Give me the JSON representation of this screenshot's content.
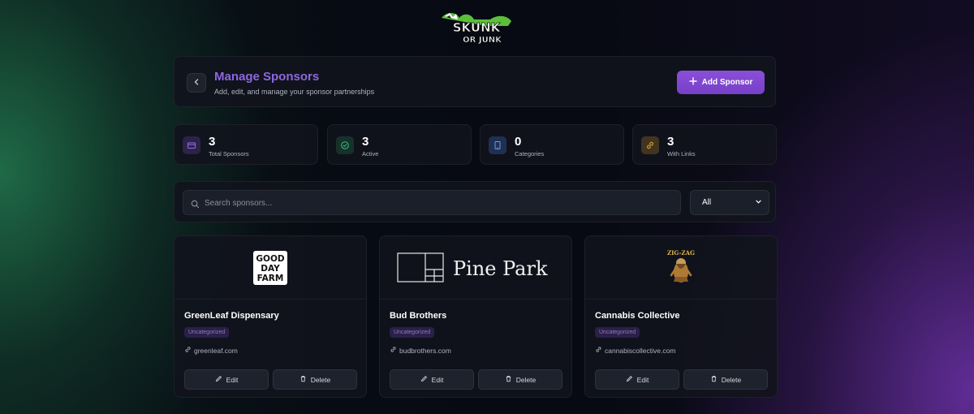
{
  "logo": {
    "text_top": "SKUNK",
    "text_bottom": "OR JUNK"
  },
  "header": {
    "title": "Manage Sponsors",
    "subtitle": "Add, edit, and manage your sponsor partnerships",
    "add_button": "Add Sponsor"
  },
  "stats": [
    {
      "value": "3",
      "label": "Total Sponsors",
      "icon": "card-icon",
      "color": "#7c4fd0"
    },
    {
      "value": "3",
      "label": "Active",
      "icon": "check-circle-icon",
      "color": "#2f9e66"
    },
    {
      "value": "0",
      "label": "Categories",
      "icon": "tablet-icon",
      "color": "#4a7fe0"
    },
    {
      "value": "3",
      "label": "With Links",
      "icon": "link-icon",
      "color": "#d8a12a"
    }
  ],
  "search": {
    "placeholder": "Search sponsors...",
    "filter_value": "All"
  },
  "sponsors": [
    {
      "name": "GreenLeaf Dispensary",
      "category": "Uncategorized",
      "url": "greenleaf.com",
      "logo_lines": [
        "GOOD",
        "DAY",
        "FARM"
      ],
      "edit": "Edit",
      "delete": "Delete"
    },
    {
      "name": "Bud Brothers",
      "category": "Uncategorized",
      "url": "budbrothers.com",
      "logo_text": "Pine Park",
      "edit": "Edit",
      "delete": "Delete"
    },
    {
      "name": "Cannabis Collective",
      "category": "Uncategorized",
      "url": "cannabiscollective.com",
      "logo_text": "ZIG-ZAG",
      "edit": "Edit",
      "delete": "Delete"
    }
  ]
}
